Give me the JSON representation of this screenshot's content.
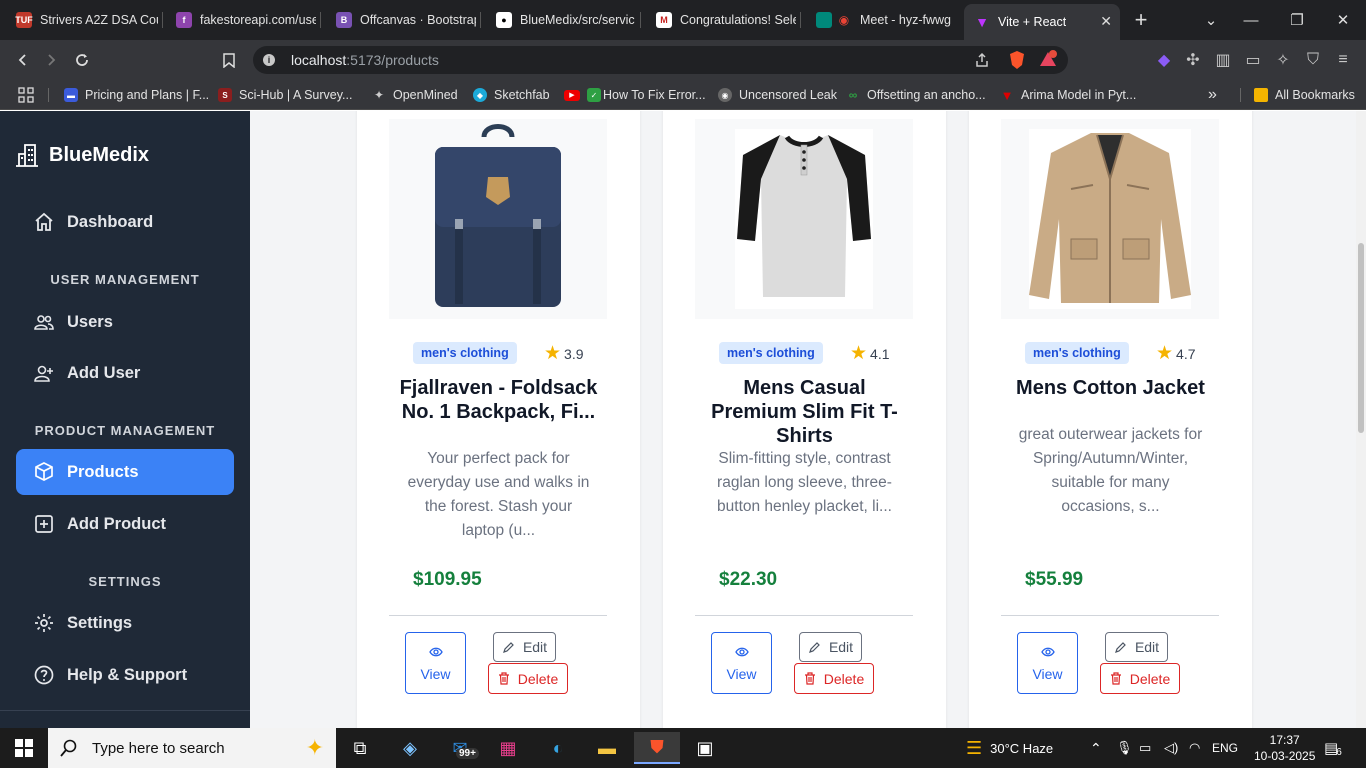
{
  "browser": {
    "tabs": [
      {
        "title": "Strivers A2Z DSA Cou",
        "fav": "TUF",
        "color": "#c0392b"
      },
      {
        "title": "fakestoreapi.com/use",
        "fav": "f",
        "color": "#8e44ad"
      },
      {
        "title": "Offcanvas · Bootstrap",
        "fav": "B",
        "color": "#7952b3"
      },
      {
        "title": "BlueMedix/src/servic",
        "fav": "gh",
        "color": "#333"
      },
      {
        "title": "Congratulations! Sele",
        "fav": "M",
        "color": "#c5221f"
      },
      {
        "title": "Meet - hyz-fwwg",
        "fav": "●",
        "color": "#00897b"
      },
      {
        "title": "Vite + React",
        "fav": "V",
        "color": "#646cff"
      }
    ],
    "url_host": "localhost",
    "url_path": ":5173/products",
    "bookmarks": [
      {
        "label": "Pricing and Plans | F...",
        "color": "#3b5bdb"
      },
      {
        "label": "Sci-Hub | A Survey...",
        "color": "#8b1e1e"
      },
      {
        "label": "OpenMined",
        "color": "#444"
      },
      {
        "label": "Sketchfab",
        "color": "#1caad9"
      },
      {
        "label": "",
        "color": "#e00"
      },
      {
        "label": "How To Fix Error...",
        "color": "#2ea043"
      },
      {
        "label": "Uncensored Leak",
        "color": "#666"
      },
      {
        "label": "Offsetting an ancho...",
        "color": "#2ea043"
      },
      {
        "label": "Arima Model in Pyt...",
        "color": "#c00"
      }
    ],
    "all_bookmarks": "All Bookmarks"
  },
  "sidebar": {
    "brand": "BlueMedix",
    "dashboard": "Dashboard",
    "section_users": "USER MANAGEMENT",
    "users": "Users",
    "add_user": "Add User",
    "section_products": "PRODUCT MANAGEMENT",
    "products": "Products",
    "add_product": "Add Product",
    "section_settings": "SETTINGS",
    "settings": "Settings",
    "help": "Help & Support"
  },
  "products": [
    {
      "category": "men's clothing",
      "rating": "3.9",
      "title": "Fjallraven - Foldsack No. 1 Backpack, Fi...",
      "description": "Your perfect pack for everyday use and walks in the forest. Stash your laptop (u...",
      "price": "$109.95"
    },
    {
      "category": "men's clothing",
      "rating": "4.1",
      "title": "Mens Casual Premium Slim Fit T-Shirts",
      "description": "Slim-fitting style, contrast raglan long sleeve, three-button henley placket, li...",
      "price": "$22.30"
    },
    {
      "category": "men's clothing",
      "rating": "4.7",
      "title": "Mens Cotton Jacket",
      "description": "great outerwear jackets for Spring/Autumn/Winter, suitable for many occasions, s...",
      "price": "$55.99"
    }
  ],
  "actions": {
    "view": "View",
    "edit": "Edit",
    "delete": "Delete"
  },
  "taskbar": {
    "search_placeholder": "Type here to search",
    "mail_badge": "99+",
    "weather": "30°C  Haze",
    "language": "ENG",
    "time": "17:37",
    "date": "10-03-2025",
    "notifications": "6"
  }
}
